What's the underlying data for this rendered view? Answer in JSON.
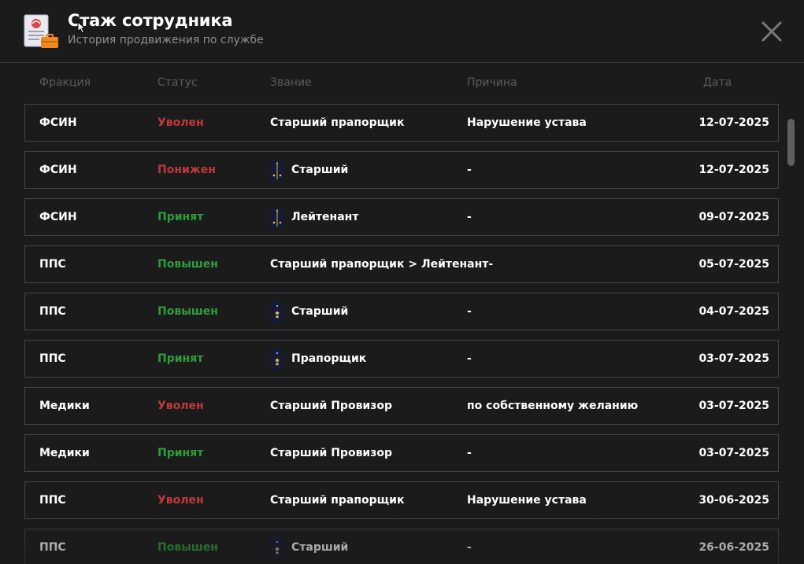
{
  "header": {
    "title": "Стаж сотрудника",
    "subtitle": "История продвижения по службе"
  },
  "columns": {
    "faction": "Фракция",
    "status": "Статус",
    "rank": "Звание",
    "reason": "Причина",
    "date": "Дата"
  },
  "colors": {
    "background": "#1b1b1b",
    "fired": "#c0393b",
    "demoted": "#c0393b",
    "accepted": "#2e9e3a",
    "promoted": "#2e9e3a",
    "border": "#444444",
    "muted": "#8e8e8e"
  },
  "rows": [
    {
      "faction": "ФСИН",
      "status": "Уволен",
      "status_color": "#c0393b",
      "rank": "Старший прапорщик",
      "rank_icon": "",
      "reason": "Нарушение устава",
      "date": "12-07-2025"
    },
    {
      "faction": "ФСИН",
      "status": "Понижен",
      "status_color": "#c0393b",
      "rank": "Старший",
      "rank_icon": "fsin-insignia-icon",
      "reason": "-",
      "date": "12-07-2025"
    },
    {
      "faction": "ФСИН",
      "status": "Принят",
      "status_color": "#2e9e3a",
      "rank": "Лейтенант",
      "rank_icon": "fsin-insignia-icon",
      "reason": "-",
      "date": "09-07-2025"
    },
    {
      "faction": "ППС",
      "status": "Повышен",
      "status_color": "#2e9e3a",
      "rank": "Старший прапорщик > Лейтенант-",
      "rank_icon": "",
      "reason": "",
      "date": "05-07-2025"
    },
    {
      "faction": "ППС",
      "status": "Повышен",
      "status_color": "#2e9e3a",
      "rank": "Старший",
      "rank_icon": "pps-insignia-icon",
      "reason": "-",
      "date": "04-07-2025"
    },
    {
      "faction": "ППС",
      "status": "Принят",
      "status_color": "#2e9e3a",
      "rank": "Прапорщик",
      "rank_icon": "pps-insignia-icon",
      "reason": "-",
      "date": "03-07-2025"
    },
    {
      "faction": "Медики",
      "status": "Уволен",
      "status_color": "#c0393b",
      "rank": "Старший Провизор",
      "rank_icon": "",
      "reason": "по собственному желанию",
      "date": "03-07-2025"
    },
    {
      "faction": "Медики",
      "status": "Принят",
      "status_color": "#2e9e3a",
      "rank": "Старший Провизор",
      "rank_icon": "",
      "reason": "-",
      "date": "03-07-2025"
    },
    {
      "faction": "ППС",
      "status": "Уволен",
      "status_color": "#c0393b",
      "rank": "Старший прапорщик",
      "rank_icon": "",
      "reason": "Нарушение устава",
      "date": "30-06-2025"
    },
    {
      "faction": "ППС",
      "status": "Повышен",
      "status_color": "#2e9e3a",
      "rank": "Старший",
      "rank_icon": "pps-insignia-icon",
      "reason": "-",
      "date": "26-06-2025"
    }
  ],
  "icons": {
    "header": "document-briefcase-icon",
    "close": "close-icon",
    "cursor": "mouse-cursor-icon"
  }
}
